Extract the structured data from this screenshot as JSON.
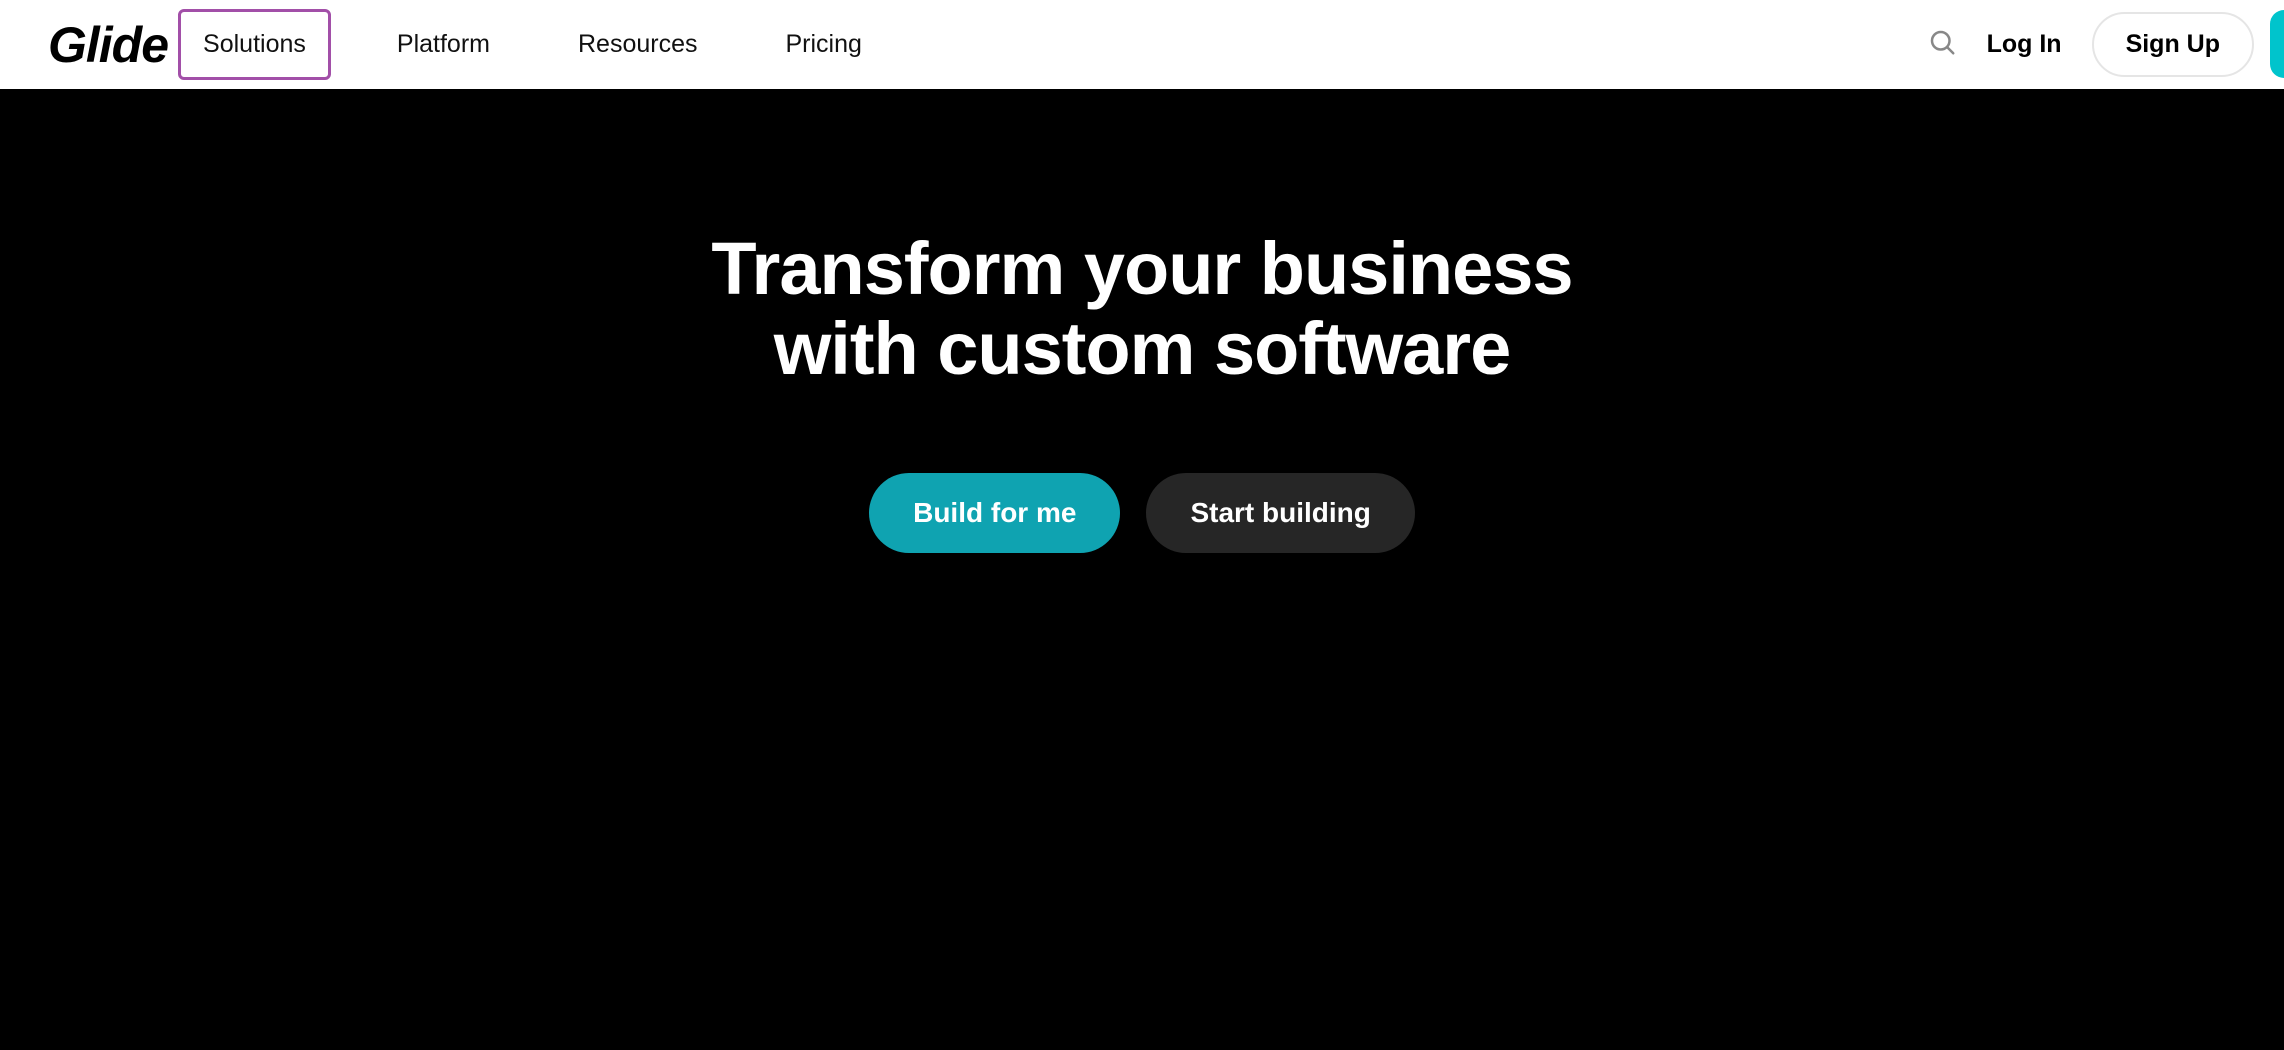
{
  "header": {
    "logo": "Glide",
    "nav": {
      "solutions": "Solutions",
      "platform": "Platform",
      "resources": "Resources",
      "pricing": "Pricing"
    },
    "login": "Log In",
    "signup": "Sign Up"
  },
  "hero": {
    "title_line1": "Transform your business",
    "title_line2": "with custom software",
    "cta_primary": "Build for me",
    "cta_secondary": "Start building"
  },
  "colors": {
    "accent": "#00c4cc",
    "primary_button": "#0fa3b1",
    "highlight_border": "#a24fa8"
  }
}
